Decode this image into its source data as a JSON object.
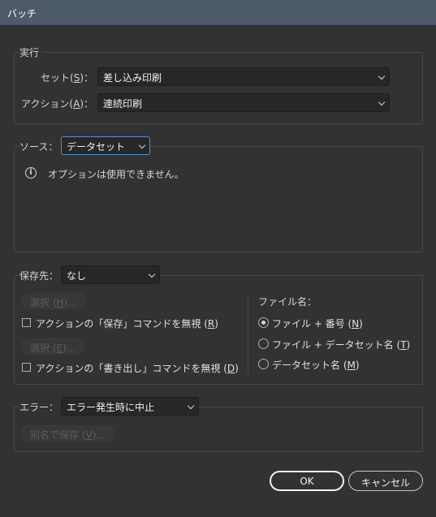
{
  "window": {
    "title": "バッチ"
  },
  "play": {
    "legend": "実行",
    "set_label_pre": "セット(",
    "set_label_key": "S",
    "set_label_post": ")：",
    "set_value": "差し込み印刷",
    "action_label_pre": "アクション(",
    "action_label_key": "A",
    "action_label_post": ")：",
    "action_value": "連続印刷"
  },
  "source": {
    "label": "ソース：",
    "value": "データセット",
    "info_text": "オプションは使用できません。",
    "info_icon": "info-icon"
  },
  "destination": {
    "label": "保存先：",
    "value": "なし",
    "choose_button_1_pre": "選択 (",
    "choose_button_1_key": "H",
    "choose_button_1_post": ")...",
    "override_save_pre": "アクションの「保存」コマンドを無視 (",
    "override_save_key": "R",
    "override_save_post": ")",
    "override_save_checked": false,
    "choose_button_2_pre": "選択 (",
    "choose_button_2_key": "E",
    "choose_button_2_post": ")...",
    "override_export_pre": "アクションの「書き出し」コマンドを無視 (",
    "override_export_key": "D",
    "override_export_post": ")",
    "override_export_checked": false,
    "filename_label": "ファイル名：",
    "radio_1_pre": "ファイル + 番号 (",
    "radio_1_key": "N",
    "radio_1_post": ")",
    "radio_2_pre": "ファイル + データセット名 (",
    "radio_2_key": "T",
    "radio_2_post": ")",
    "radio_3_pre": "データセット名 (",
    "radio_3_key": "M",
    "radio_3_post": ")",
    "selected_radio": 1
  },
  "errors": {
    "label": "エラー：",
    "value": "エラー発生時に中止",
    "save_as_pre": "別名で保存 (",
    "save_as_key": "V",
    "save_as_post": ")..."
  },
  "buttons": {
    "ok": "OK",
    "cancel": "キャンセル"
  },
  "colors": {
    "titlebar": "#4d5a6a",
    "background": "#323232",
    "focus": "#4d8fd6"
  }
}
